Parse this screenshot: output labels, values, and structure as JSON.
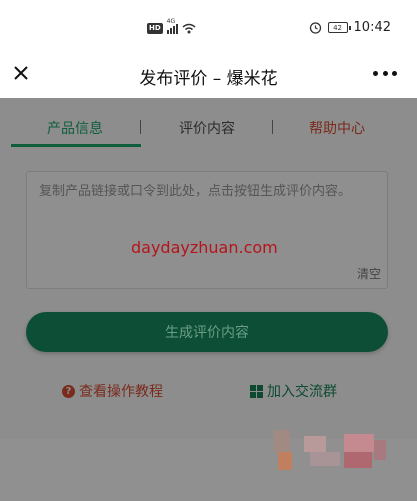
{
  "status_bar": {
    "hd_badge": "HD",
    "network": "4G",
    "battery": "42",
    "time": "10:42"
  },
  "header": {
    "title": "发布评价 – 爆米花",
    "close_icon": "close-icon",
    "more_icon": "more-icon"
  },
  "tabs": [
    {
      "label": "产品信息",
      "active": true
    },
    {
      "label": "评价内容",
      "active": false
    },
    {
      "label": "帮助中心",
      "active": false
    }
  ],
  "form": {
    "placeholder": "复制产品链接或口令到此处，点击按钮生成评价内容。",
    "clear_label": "清空"
  },
  "watermark": "daydayzhuan.com",
  "actions": {
    "generate_label": "生成评价内容",
    "tutorial_label": "查看操作教程",
    "group_label": "加入交流群"
  },
  "colors": {
    "accent_green": "#0d4f36",
    "help_red": "#7a2b1b",
    "watermark_red": "#b5141a"
  }
}
